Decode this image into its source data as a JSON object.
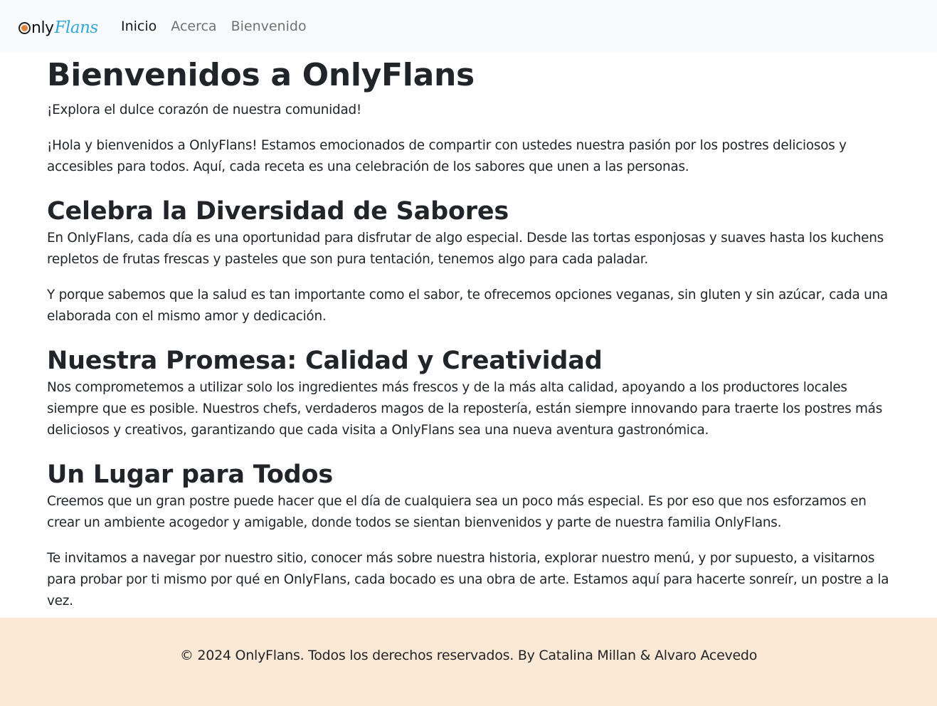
{
  "brand": {
    "part1": "nly",
    "part2": "Flans"
  },
  "nav": [
    {
      "label": "Inicio"
    },
    {
      "label": "Acerca"
    },
    {
      "label": "Bienvenido"
    }
  ],
  "page_title": "Bienvenidos a OnlyFlans",
  "lead": "¡Explora el dulce corazón de nuestra comunidad!",
  "intro": "¡Hola y bienvenidos a OnlyFlans! Estamos emocionados de compartir con ustedes nuestra pasión por los postres deliciosos y accesibles para todos. Aquí, cada receta es una celebración de los sabores que unen a las personas.",
  "sections": [
    {
      "heading": "Celebra la Diversidad de Sabores",
      "paragraphs": [
        "En OnlyFlans, cada día es una oportunidad para disfrutar de algo especial. Desde las tortas esponjosas y suaves hasta los kuchens repletos de frutas frescas y pasteles que son pura tentación, tenemos algo para cada paladar.",
        "Y porque sabemos que la salud es tan importante como el sabor, te ofrecemos opciones veganas, sin gluten y sin azúcar, cada una elaborada con el mismo amor y dedicación."
      ]
    },
    {
      "heading": "Nuestra Promesa: Calidad y Creatividad",
      "paragraphs": [
        "Nos comprometemos a utilizar solo los ingredientes más frescos y de la más alta calidad, apoyando a los productores locales siempre que es posible. Nuestros chefs, verdaderos magos de la repostería, están siempre innovando para traerte los postres más deliciosos y creativos, garantizando que cada visita a OnlyFlans sea una nueva aventura gastronómica."
      ]
    },
    {
      "heading": "Un Lugar para Todos",
      "paragraphs": [
        "Creemos que un gran postre puede hacer que el día de cualquiera sea un poco más especial. Es por eso que nos esforzamos en crear un ambiente acogedor y amigable, donde todos se sientan bienvenidos y parte de nuestra familia OnlyFlans.",
        "Te invitamos a navegar por nuestro sitio, conocer más sobre nuestra historia, explorar nuestro menú, y por supuesto, a visitarnos para probar por ti mismo por qué en OnlyFlans, cada bocado es una obra de arte. Estamos aquí para hacerte sonreír, un postre a la vez."
      ]
    }
  ],
  "footer": "© 2024 OnlyFlans. Todos los derechos reservados. By Catalina Millan & Alvaro Acevedo",
  "colors": {
    "navbar_bg": "#f8f9fa",
    "footer_bg": "#fbe9d6",
    "brand_accent": "#33a7d8",
    "brand_dot": "#e0843a"
  }
}
